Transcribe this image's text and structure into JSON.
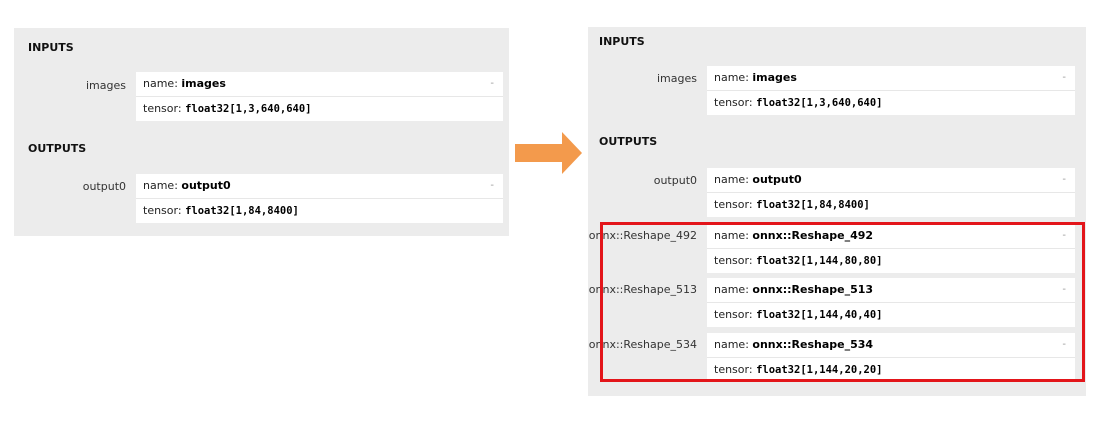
{
  "left": {
    "inputs_title": "INPUTS",
    "outputs_title": "OUTPUTS",
    "inputs": [
      {
        "label": "images",
        "name_key": "name:",
        "name_value": "images",
        "tensor_key": "tensor:",
        "tensor_value": "float32[1,3,640,640]",
        "toggle": "-"
      }
    ],
    "outputs": [
      {
        "label": "output0",
        "name_key": "name:",
        "name_value": "output0",
        "tensor_key": "tensor:",
        "tensor_value": "float32[1,84,8400]",
        "toggle": "-"
      }
    ]
  },
  "right": {
    "inputs_title": "INPUTS",
    "outputs_title": "OUTPUTS",
    "inputs": [
      {
        "label": "images",
        "name_key": "name:",
        "name_value": "images",
        "tensor_key": "tensor:",
        "tensor_value": "float32[1,3,640,640]",
        "toggle": "-"
      }
    ],
    "outputs": [
      {
        "label": "output0",
        "name_key": "name:",
        "name_value": "output0",
        "tensor_key": "tensor:",
        "tensor_value": "float32[1,84,8400]",
        "toggle": "-"
      },
      {
        "label": "onnx::Reshape_492",
        "name_key": "name:",
        "name_value": "onnx::Reshape_492",
        "tensor_key": "tensor:",
        "tensor_value": "float32[1,144,80,80]",
        "toggle": "-"
      },
      {
        "label": "onnx::Reshape_513",
        "name_key": "name:",
        "name_value": "onnx::Reshape_513",
        "tensor_key": "tensor:",
        "tensor_value": "float32[1,144,40,40]",
        "toggle": "-"
      },
      {
        "label": "onnx::Reshape_534",
        "name_key": "name:",
        "name_value": "onnx::Reshape_534",
        "tensor_key": "tensor:",
        "tensor_value": "float32[1,144,20,20]",
        "toggle": "-"
      }
    ]
  },
  "colors": {
    "arrow": "#f39a4c",
    "highlight": "#e3151a",
    "panel_bg": "#ececec"
  }
}
